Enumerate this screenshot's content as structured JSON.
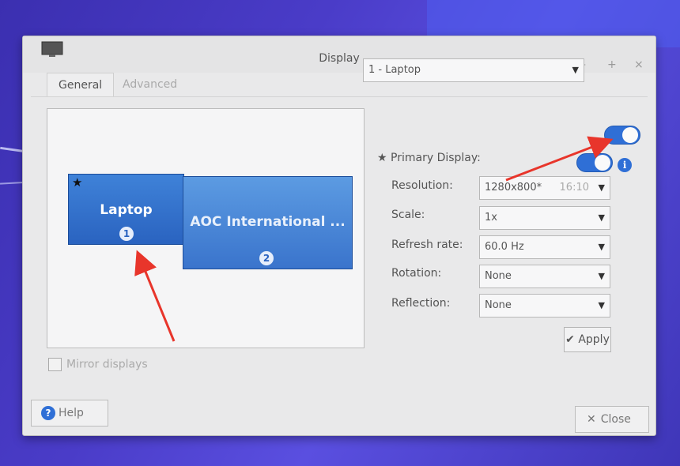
{
  "window": {
    "title": "Display",
    "minimize": "–",
    "maximize": "+",
    "close": "×"
  },
  "tabs": [
    {
      "label": "General",
      "active": true
    },
    {
      "label": "Advanced",
      "active": false
    }
  ],
  "preview": {
    "displays": [
      {
        "name": "Laptop",
        "number": "1",
        "primary": true
      },
      {
        "name": "AOC International ...",
        "number": "2",
        "primary": false
      }
    ],
    "primary_star": "★"
  },
  "mirror": {
    "label": "Mirror displays",
    "checked": false
  },
  "display_select": {
    "value": "1 - Laptop",
    "enabled": true
  },
  "primary": {
    "star": "★",
    "label": "Primary Display:",
    "enabled": true,
    "info": "i"
  },
  "settings": {
    "resolution": {
      "label": "Resolution:",
      "value": "1280x800*",
      "aspect": "16:10"
    },
    "scale": {
      "label": "Scale:",
      "value": "1x"
    },
    "refresh": {
      "label": "Refresh rate:",
      "value": "60.0 Hz"
    },
    "rotation": {
      "label": "Rotation:",
      "value": "None"
    },
    "reflection": {
      "label": "Reflection:",
      "value": "None"
    }
  },
  "buttons": {
    "apply": "Apply",
    "apply_icon": "✔",
    "help": "Help",
    "help_icon": "?",
    "close": "Close",
    "close_icon": "✕"
  },
  "colors": {
    "accent": "#2f6fd6",
    "annotation": "#e8352b"
  }
}
